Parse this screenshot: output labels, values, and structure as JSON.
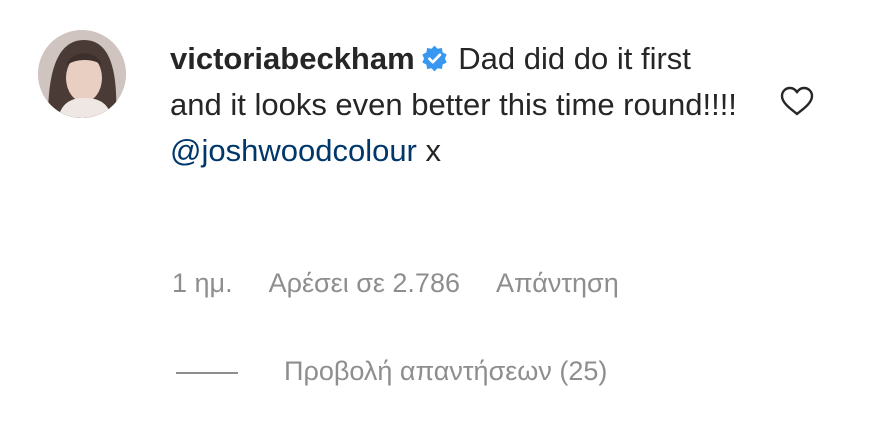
{
  "comment": {
    "username": "victoriabeckham",
    "verified_icon": "verified-badge-icon",
    "text_before": "Dad did do it first and it looks even better this time round!!!!",
    "mention": "@joshwoodcolour",
    "text_after": "x",
    "time_ago": "1 ημ.",
    "likes": "Αρέσει σε 2.786",
    "reply_label": "Απάντηση",
    "view_replies": "Προβολή απαντήσεων (25)",
    "like_icon": "heart-icon"
  },
  "colors": {
    "text": "#262626",
    "secondary": "#8e8e8e",
    "mention": "#00376b",
    "verified": "#3897f0"
  }
}
